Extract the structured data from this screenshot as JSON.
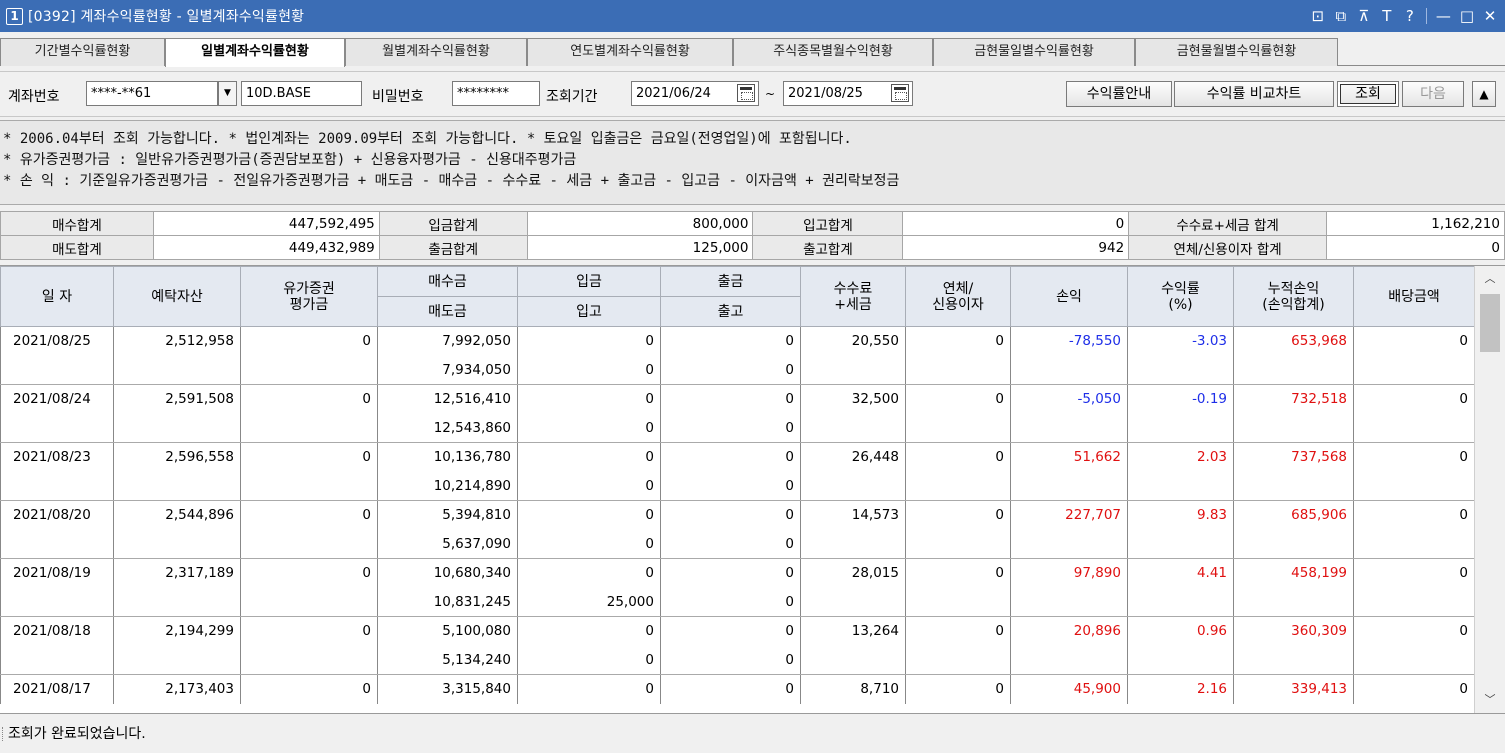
{
  "window": {
    "screen_no": "1",
    "title": "[0392] 계좌수익률현황 - 일별계좌수익률현황",
    "controls": [
      "⊡",
      "⧉",
      "⊼",
      "T",
      "?",
      "—",
      "□",
      "✕"
    ]
  },
  "tabs": [
    {
      "label": "기간별수익률현황",
      "active": false
    },
    {
      "label": "일별계좌수익률현황",
      "active": true
    },
    {
      "label": "월별계좌수익률현황",
      "active": false
    },
    {
      "label": "연도별계좌수익률현황",
      "active": false
    },
    {
      "label": "주식종목별월수익현황",
      "active": false
    },
    {
      "label": "금현물일별수익률현황",
      "active": false
    },
    {
      "label": "금현물월별수익률현황",
      "active": false
    }
  ],
  "query": {
    "account_label": "계좌번호",
    "account_value": "****-**61",
    "account_name": "10D.BASE",
    "password_label": "비밀번호",
    "password_value": "********",
    "period_label": "조회기간",
    "start_date": "2021/06/24",
    "tilde": "~",
    "end_date": "2021/08/25",
    "btn_guide": "수익률안내",
    "btn_compare": "수익률 비교차트",
    "btn_query": "조회",
    "btn_next": "다음",
    "btn_collapse": "▲"
  },
  "info_lines": [
    "* 2006.04부터 조회 가능합니다.   * 법인계좌는 2009.09부터 조회 가능합니다.   * 토요일 입출금은 금요일(전영업일)에 포함됩니다.",
    "* 유가증권평가금 : 일반유가증권평가금(증권담보포함) + 신용융자평가금 - 신용대주평가금",
    "* 손        익 : 기준일유가증권평가금 - 전일유가증권평가금 + 매도금 - 매수금 - 수수료 - 세금 + 출고금 - 입고금 - 이자금액 + 권리락보정금"
  ],
  "summary": [
    [
      {
        "label": "매수합계",
        "value": "447,592,495"
      },
      {
        "label": "입금합계",
        "value": "800,000"
      },
      {
        "label": "입고합계",
        "value": "0"
      },
      {
        "label": "수수료+세금 합계",
        "value": "1,162,210"
      }
    ],
    [
      {
        "label": "매도합계",
        "value": "449,432,989"
      },
      {
        "label": "출금합계",
        "value": "125,000"
      },
      {
        "label": "출고합계",
        "value": "942"
      },
      {
        "label": "연체/신용이자 합계",
        "value": "0"
      }
    ]
  ],
  "grid_headers": {
    "date": "일 자",
    "deposit": "예탁자산",
    "securities": [
      "유가증권",
      "평가금"
    ],
    "buy": "매수금",
    "sell": "매도금",
    "in_cash": "입금",
    "in_stock": "입고",
    "out_cash": "출금",
    "out_stock": "출고",
    "fee": [
      "수수료",
      "+세금"
    ],
    "interest": [
      "연체/",
      "신용이자"
    ],
    "pnl": "손익",
    "rate": [
      "수익률",
      "(%)"
    ],
    "cum": [
      "누적손익",
      "(손익합계)"
    ],
    "dividend": "배당금액"
  },
  "rows": [
    {
      "date": "2021/08/25",
      "deposit": "2,512,958",
      "securities": "0",
      "buy": "7,992,050",
      "sell": "7,934,050",
      "in_cash": "0",
      "in_stock": "0",
      "out_cash": "0",
      "out_stock": "0",
      "fee": "20,550",
      "interest": "0",
      "pnl": "-78,550",
      "rate": "-3.03",
      "cum": "653,968",
      "dividend": "0",
      "sign": "neg"
    },
    {
      "date": "2021/08/24",
      "deposit": "2,591,508",
      "securities": "0",
      "buy": "12,516,410",
      "sell": "12,543,860",
      "in_cash": "0",
      "in_stock": "0",
      "out_cash": "0",
      "out_stock": "0",
      "fee": "32,500",
      "interest": "0",
      "pnl": "-5,050",
      "rate": "-0.19",
      "cum": "732,518",
      "dividend": "0",
      "sign": "neg"
    },
    {
      "date": "2021/08/23",
      "deposit": "2,596,558",
      "securities": "0",
      "buy": "10,136,780",
      "sell": "10,214,890",
      "in_cash": "0",
      "in_stock": "0",
      "out_cash": "0",
      "out_stock": "0",
      "fee": "26,448",
      "interest": "0",
      "pnl": "51,662",
      "rate": "2.03",
      "cum": "737,568",
      "dividend": "0",
      "sign": "pos"
    },
    {
      "date": "2021/08/20",
      "deposit": "2,544,896",
      "securities": "0",
      "buy": "5,394,810",
      "sell": "5,637,090",
      "in_cash": "0",
      "in_stock": "0",
      "out_cash": "0",
      "out_stock": "0",
      "fee": "14,573",
      "interest": "0",
      "pnl": "227,707",
      "rate": "9.83",
      "cum": "685,906",
      "dividend": "0",
      "sign": "pos"
    },
    {
      "date": "2021/08/19",
      "deposit": "2,317,189",
      "securities": "0",
      "buy": "10,680,340",
      "sell": "10,831,245",
      "in_cash": "0",
      "in_stock": "25,000",
      "out_cash": "0",
      "out_stock": "0",
      "fee": "28,015",
      "interest": "0",
      "pnl": "97,890",
      "rate": "4.41",
      "cum": "458,199",
      "dividend": "0",
      "sign": "pos"
    },
    {
      "date": "2021/08/18",
      "deposit": "2,194,299",
      "securities": "0",
      "buy": "5,100,080",
      "sell": "5,134,240",
      "in_cash": "0",
      "in_stock": "0",
      "out_cash": "0",
      "out_stock": "0",
      "fee": "13,264",
      "interest": "0",
      "pnl": "20,896",
      "rate": "0.96",
      "cum": "360,309",
      "dividend": "0",
      "sign": "pos"
    },
    {
      "date": "2021/08/17",
      "deposit": "2,173,403",
      "securities": "0",
      "buy": "3,315,840",
      "sell": "",
      "in_cash": "0",
      "in_stock": "",
      "out_cash": "0",
      "out_stock": "",
      "fee": "8,710",
      "interest": "0",
      "pnl": "45,900",
      "rate": "2.16",
      "cum": "339,413",
      "dividend": "0",
      "sign": "pos"
    }
  ],
  "status": "조회가 완료되었습니다.",
  "colors": {
    "titlebar": "#3b6db5",
    "positive": "#e01010",
    "negative": "#1e2ee8",
    "header_bg": "#e4e9f1"
  }
}
